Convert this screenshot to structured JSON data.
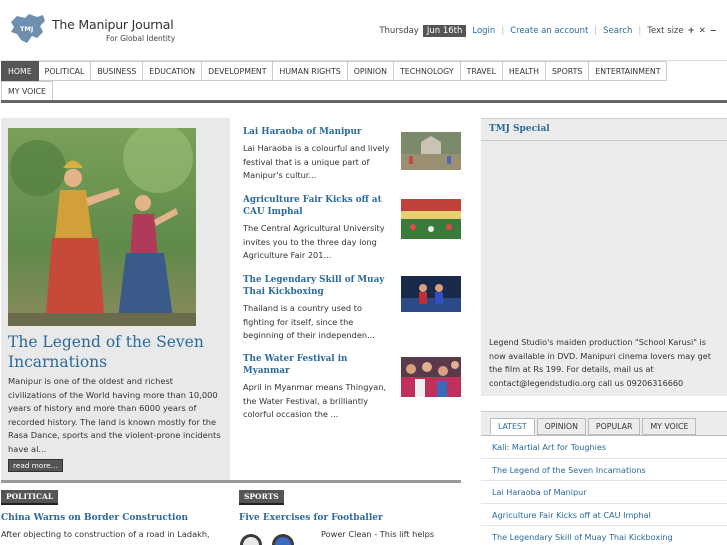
{
  "site": {
    "title": "The Manipur Journal",
    "tagline": "For Global Identity",
    "logo_text": "TMJ"
  },
  "topbar": {
    "day": "Thursday",
    "date": "Jun 16th",
    "login": "Login",
    "create_account": "Create an account",
    "search": "Search",
    "text_size": "Text size",
    "ts_plus": "+",
    "ts_reset": "✕",
    "ts_minus": "−"
  },
  "nav": {
    "row1": [
      "HOME",
      "POLITICAL",
      "BUSINESS",
      "EDUCATION",
      "DEVELOPMENT",
      "HUMAN RIGHTS",
      "OPINION",
      "TECHNOLOGY",
      "TRAVEL",
      "HEALTH",
      "SPORTS",
      "ENTERTAINMENT"
    ],
    "row2": [
      "MY VOICE"
    ],
    "active": "HOME"
  },
  "hero": {
    "title": "The Legend of the Seven Incarnations",
    "text": "Manipur is one of the oldest and richest civilizations of the World having more than 10,000 years of history and more than 6000 years of recorded history. The land is known mostly for the Rasa Dance, sports and the violent-prone incidents have al...",
    "read_more": "read more..."
  },
  "stories": [
    {
      "title": "Lai Haraoba of Manipur",
      "text": "Lai Haraoba is a colourful and lively festival that is a unique part of Manipur's cultur..."
    },
    {
      "title": "Agriculture Fair Kicks off at CAU Imphal",
      "text": "The Central Agricultural University invites you to the three day long Agriculture Fair 201..."
    },
    {
      "title": "The Legendary Skill of Muay Thai Kickboxing",
      "text": "Thailand is a country used to fighting for itself, since the beginning of their independen..."
    },
    {
      "title": "The Water Festival in Myanmar",
      "text": "April in Myanmar means Thingyan, the Water Festival, a brilliantly colorful occasion the ..."
    }
  ],
  "sections": [
    {
      "tag": "POLITICAL",
      "headline": "China Warns on Border Construction",
      "text": "After objecting to construction of a road in Ladakh,"
    },
    {
      "tag": "SPORTS",
      "headline": "Five Exercises for Footballer",
      "text": "Power Clean - This lift helps"
    }
  ],
  "special": {
    "title": "TMJ Special",
    "text": "Legend Studio's maiden production \"School Karusi\" is now available in DVD. Manipuri cinema lovers may get the film at Rs 199. For details, mail us at contact@legendstudio.org call us 09206316660"
  },
  "latest": {
    "tabs": [
      "LATEST",
      "OPINION",
      "POPULAR",
      "MY VOICE"
    ],
    "active_tab": "LATEST",
    "items": [
      "Kali: Martial Art for Toughies",
      "The Legend of the Seven Incarnations",
      "Lai Haraoba of Manipur",
      "Agriculture Fair Kicks off at CAU Imphal",
      "The Legendary Skill of Muay Thai Kickboxing"
    ]
  },
  "colors": {
    "link": "#2a6a9c",
    "nav_active": "#555555",
    "panel": "#ececec"
  }
}
